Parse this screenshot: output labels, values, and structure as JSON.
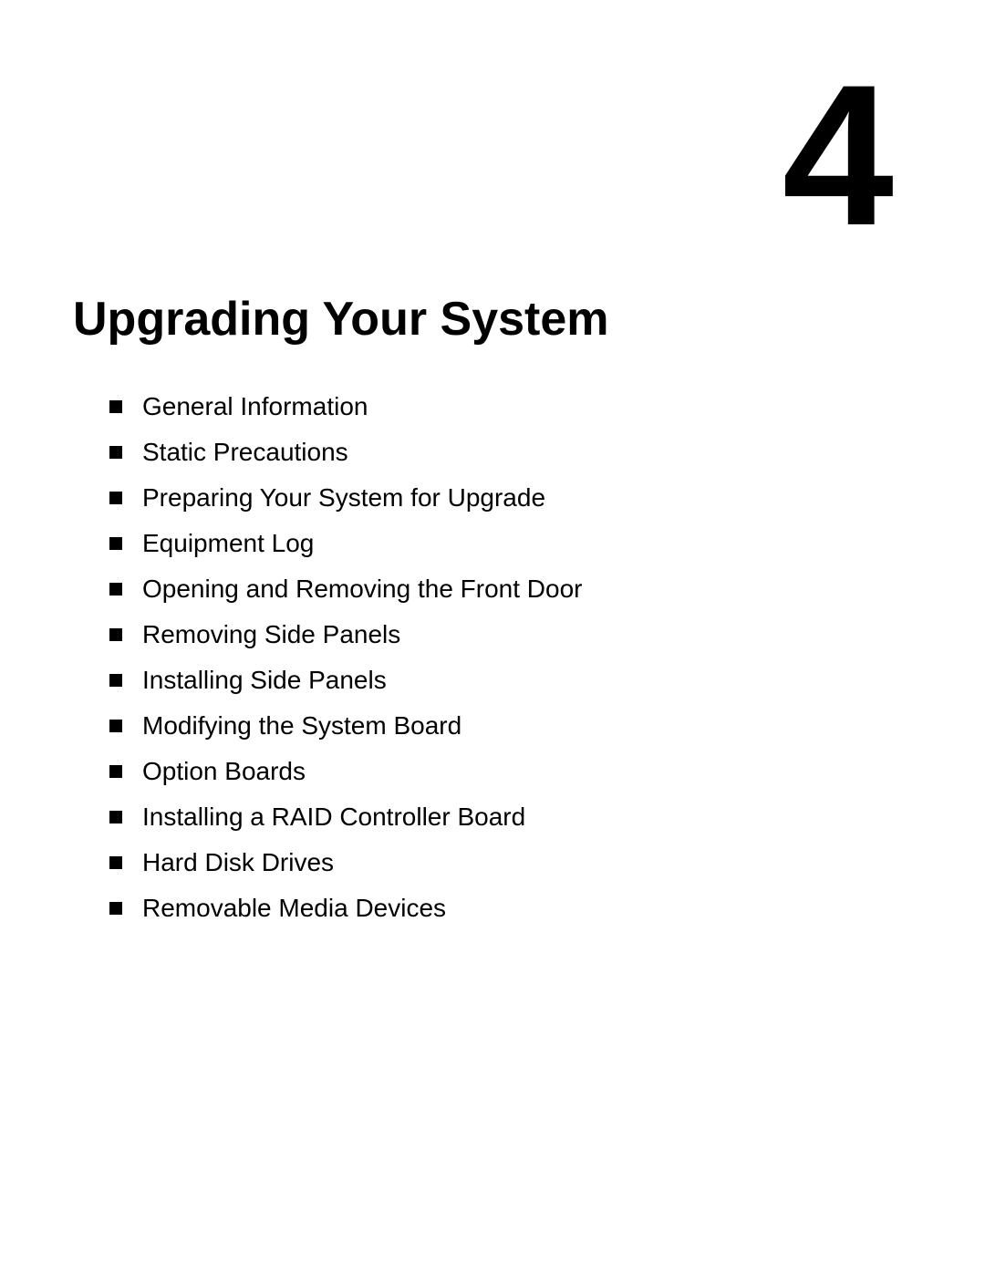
{
  "chapter": {
    "number": "4",
    "title": "Upgrading Your System"
  },
  "toc": {
    "items": [
      {
        "label": "General Information"
      },
      {
        "label": "Static Precautions"
      },
      {
        "label": "Preparing Your System for Upgrade"
      },
      {
        "label": "Equipment Log"
      },
      {
        "label": "Opening and Removing the Front Door"
      },
      {
        "label": "Removing Side Panels"
      },
      {
        "label": "Installing Side Panels"
      },
      {
        "label": "Modifying the System Board"
      },
      {
        "label": "Option Boards"
      },
      {
        "label": "Installing a RAID Controller Board"
      },
      {
        "label": "Hard Disk Drives"
      },
      {
        "label": "Removable Media Devices"
      }
    ]
  }
}
